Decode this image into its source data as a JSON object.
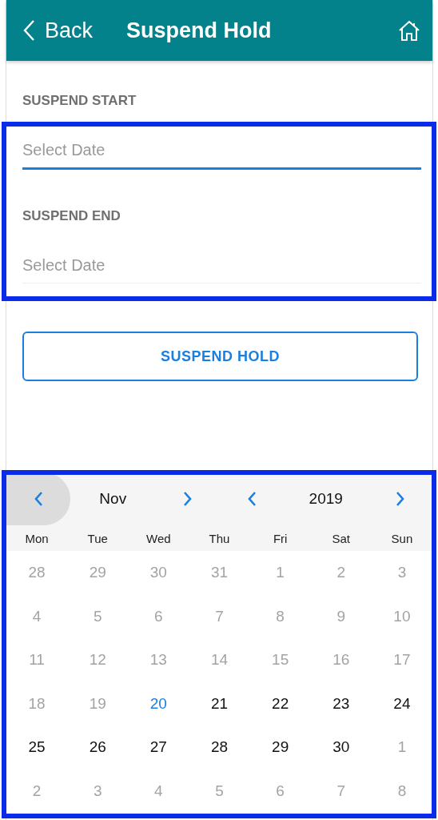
{
  "header": {
    "back": "Back",
    "title": "Suspend Hold"
  },
  "fields": [
    {
      "label": "SUSPEND START",
      "placeholder": "Select Date",
      "focused": true
    },
    {
      "label": "SUSPEND END",
      "placeholder": "Select Date",
      "focused": false
    }
  ],
  "action": "SUSPEND HOLD",
  "calendar": {
    "month": "Nov",
    "year": "2019",
    "prev_month_pressed": true,
    "weekdays": [
      "Mon",
      "Tue",
      "Wed",
      "Thu",
      "Fri",
      "Sat",
      "Sun"
    ],
    "days": [
      {
        "day": "28",
        "kind": "disabled"
      },
      {
        "day": "29",
        "kind": "disabled"
      },
      {
        "day": "30",
        "kind": "disabled"
      },
      {
        "day": "31",
        "kind": "disabled"
      },
      {
        "day": "1",
        "kind": "disabled"
      },
      {
        "day": "2",
        "kind": "disabled"
      },
      {
        "day": "3",
        "kind": "disabled"
      },
      {
        "day": "4",
        "kind": "disabled"
      },
      {
        "day": "5",
        "kind": "disabled"
      },
      {
        "day": "6",
        "kind": "disabled"
      },
      {
        "day": "7",
        "kind": "disabled"
      },
      {
        "day": "8",
        "kind": "disabled"
      },
      {
        "day": "9",
        "kind": "disabled"
      },
      {
        "day": "10",
        "kind": "disabled"
      },
      {
        "day": "11",
        "kind": "disabled"
      },
      {
        "day": "12",
        "kind": "disabled"
      },
      {
        "day": "13",
        "kind": "disabled"
      },
      {
        "day": "14",
        "kind": "disabled"
      },
      {
        "day": "15",
        "kind": "disabled"
      },
      {
        "day": "16",
        "kind": "disabled"
      },
      {
        "day": "17",
        "kind": "disabled"
      },
      {
        "day": "18",
        "kind": "disabled"
      },
      {
        "day": "19",
        "kind": "disabled"
      },
      {
        "day": "20",
        "kind": "today"
      },
      {
        "day": "21",
        "kind": "normal"
      },
      {
        "day": "22",
        "kind": "normal"
      },
      {
        "day": "23",
        "kind": "normal"
      },
      {
        "day": "24",
        "kind": "normal"
      },
      {
        "day": "25",
        "kind": "normal"
      },
      {
        "day": "26",
        "kind": "normal"
      },
      {
        "day": "27",
        "kind": "normal"
      },
      {
        "day": "28",
        "kind": "normal"
      },
      {
        "day": "29",
        "kind": "normal"
      },
      {
        "day": "30",
        "kind": "normal"
      },
      {
        "day": "1",
        "kind": "disabled"
      },
      {
        "day": "2",
        "kind": "disabled"
      },
      {
        "day": "3",
        "kind": "disabled"
      },
      {
        "day": "4",
        "kind": "disabled"
      },
      {
        "day": "5",
        "kind": "disabled"
      },
      {
        "day": "6",
        "kind": "disabled"
      },
      {
        "day": "7",
        "kind": "disabled"
      },
      {
        "day": "8",
        "kind": "disabled"
      }
    ]
  }
}
